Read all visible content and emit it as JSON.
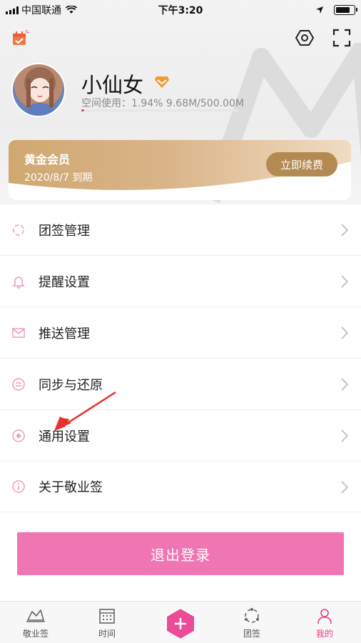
{
  "status_bar": {
    "carrier": "中国联通",
    "time": "下午3:20"
  },
  "profile": {
    "name": "小仙女",
    "storage_label": "空间使用：1.94%  9.68M/500.00M",
    "storage_percent": 1.94
  },
  "membership": {
    "title": "黄金会员",
    "expiry": "2020/8/7 到期",
    "renew_label": "立即续费"
  },
  "menu": [
    {
      "label": "团签管理",
      "icon": "group-sign-icon"
    },
    {
      "label": "提醒设置",
      "icon": "bell-icon"
    },
    {
      "label": "推送管理",
      "icon": "mail-icon"
    },
    {
      "label": "同步与还原",
      "icon": "sync-icon"
    },
    {
      "label": "通用设置",
      "icon": "general-settings-icon"
    },
    {
      "label": "关于敬业签",
      "icon": "info-icon"
    }
  ],
  "logout_label": "退出登录",
  "tabs": [
    {
      "label": "敬业签",
      "icon": "note-icon"
    },
    {
      "label": "时间",
      "icon": "calendar-grid-icon"
    },
    {
      "label": "团签",
      "icon": "team-icon"
    },
    {
      "label": "我的",
      "icon": "profile-icon",
      "active": true
    }
  ],
  "colors": {
    "accent": "#f076b3",
    "active_tab": "#ea3c8c",
    "gold": "#cfa871"
  }
}
